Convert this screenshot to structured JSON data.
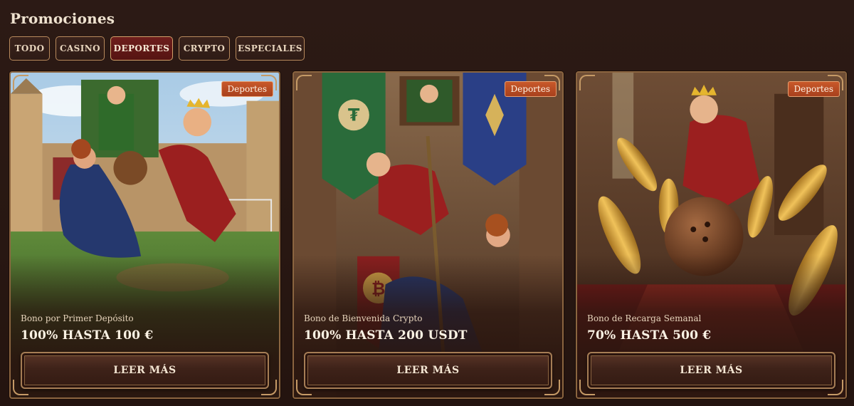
{
  "page": {
    "title": "Promociones"
  },
  "filters": [
    {
      "label": "TODO",
      "active": false
    },
    {
      "label": "CASINO",
      "active": false
    },
    {
      "label": "DEPORTES",
      "active": true
    },
    {
      "label": "CRYPTO",
      "active": false
    },
    {
      "label": "ESPECIALES",
      "active": false
    }
  ],
  "cards": [
    {
      "badge": "Deportes",
      "subtitle": "Bono por Primer Depósito",
      "amount": "100% HASTA 100 €",
      "button": "LEER MÁS"
    },
    {
      "badge": "Deportes",
      "subtitle": "Bono de Bienvenida Crypto",
      "amount": "100% HASTA 200 USDT",
      "button": "LEER MÁS"
    },
    {
      "badge": "Deportes",
      "subtitle": "Bono de Recarga Semanal",
      "amount": "70% HASTA 500 €",
      "button": "LEER MÁS"
    }
  ],
  "colors": {
    "background": "#2a1813",
    "active_filter": "#6e1e1c",
    "badge": "#c8592a",
    "frame": "#8b6540"
  }
}
